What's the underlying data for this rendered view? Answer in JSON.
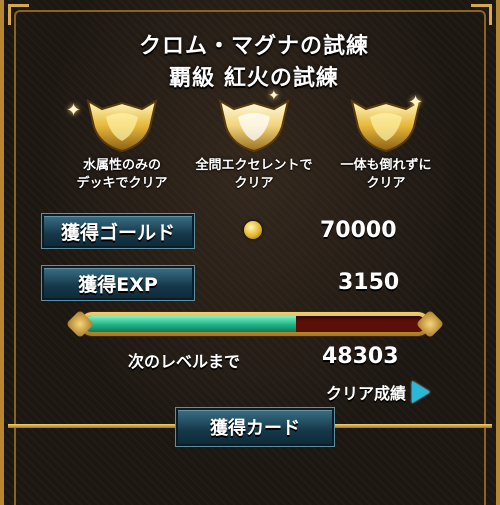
{
  "header": {
    "quest_title": "クロム・マグナの試練",
    "difficulty_title": "覇級 紅火の試練"
  },
  "missions": [
    {
      "label": "水属性のみの\nデッキでクリア",
      "icon": "crown-emblem-icon"
    },
    {
      "label": "全問エクセレントで\nクリア",
      "icon": "crown-emblem-icon"
    },
    {
      "label": "一体も倒れずに\nクリア",
      "icon": "crown-emblem-icon"
    }
  ],
  "rewards": {
    "gold_label": "獲得ゴールド",
    "gold_value": "70000",
    "exp_label": "獲得EXP",
    "exp_value": "3150"
  },
  "level": {
    "progress": 0.62,
    "next_label": "次のレベルまで",
    "next_value": "48303"
  },
  "clear_result_label": "クリア成績",
  "cards_label": "獲得カード",
  "colors": {
    "gold": "#e4b52c",
    "exp_fill": "#1fb486",
    "tag_blue": "#14384a",
    "arrow": "#29b8d8"
  }
}
